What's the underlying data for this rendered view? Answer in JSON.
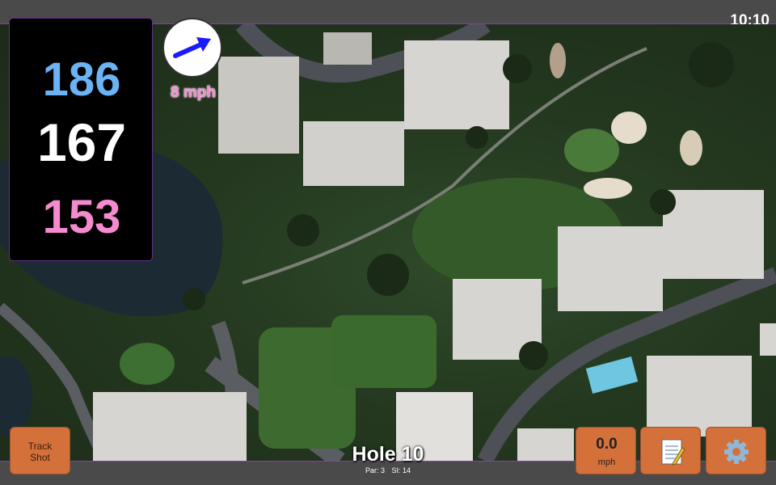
{
  "status_bar": {
    "time": "10:10"
  },
  "distances": {
    "back": "186",
    "middle": "167",
    "front": "153"
  },
  "wind": {
    "speed_label": "8 mph",
    "icon": "wind-direction-arrow-icon",
    "arrow_color": "#1a1aff"
  },
  "buttons": {
    "track_shot_line1": "Track",
    "track_shot_line2": "Shot",
    "speed_value": "0.0",
    "speed_unit": "mph",
    "notes_icon": "notepad-icon",
    "settings_icon": "gear-icon"
  },
  "hole": {
    "title": "Hole 10",
    "par": "Par: 3",
    "stroke_index": "SI: 14"
  },
  "colors": {
    "back_distance": "#6ab4f5",
    "middle_distance": "#ffffff",
    "front_distance": "#f58ad0",
    "button": "#d4703a",
    "accent_border": "#8a3fb0"
  }
}
